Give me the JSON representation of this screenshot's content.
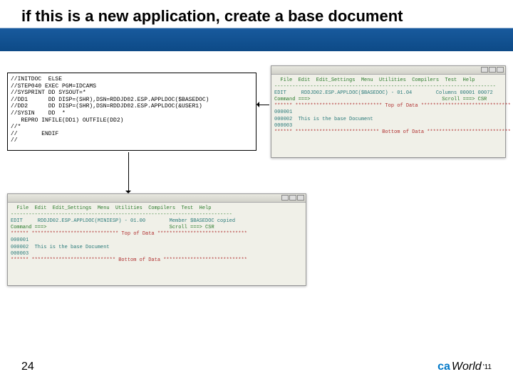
{
  "header": {
    "title": "if this is a new application, create a base document"
  },
  "jcl": {
    "lines": [
      "//INITDOC  ELSE",
      "//STEP040 EXEC PGM=IDCAMS",
      "//SYSPRINT DD SYSOUT=*",
      "//DD1      DD DISP=(SHR),DSN=RDDJD02.ESP.APPLDOC($BASEDOC)",
      "//DD2      DD DISP=(SHR),DSN=RDDJD02.ESP.APPLDOC(&USER1)",
      "//SYSIN    DD  *",
      "   REPRO INFILE(DD1) OUTFILE(DD2)",
      "//*",
      "//       ENDIF",
      "//"
    ]
  },
  "term_top": {
    "menu": "  File  Edit  Edit_Settings  Menu  Utilities  Compilers  Test  Help",
    "ruler": "--------------------------------------------------------------------------",
    "dsline": "EDIT     RDDJD02.ESP.APPLDOC($BASEDOC) - 01.04        Columns 00001 00072",
    "cmdline": "Command ===>                                            Scroll ===> CSR",
    "top": "****** ***************************** Top of Data ******************************",
    "lines": [
      "000001",
      "000002  This is the base Document",
      "000003"
    ],
    "bottom": "****** **************************** Bottom of Data ****************************"
  },
  "term_bottom": {
    "menu": "  File  Edit  Edit_Settings  Menu  Utilities  Compilers  Test  Help",
    "ruler": "--------------------------------------------------------------------------",
    "dsline": "EDIT     RDDJD02.ESP.APPLDOC(MINIESP) - 01.00        Member $BASEDOC copied",
    "cmdline": "Command ===>                                         Scroll ===> CSR",
    "top": "****** ***************************** Top of Data ******************************",
    "lines": [
      "000001",
      "000002  This is the base Document",
      "000003"
    ],
    "bottom": "****** **************************** Bottom of Data ****************************"
  },
  "footer": {
    "page": "24",
    "logo_ca": "ca",
    "logo_world": "World",
    "logo_year": "'11"
  }
}
